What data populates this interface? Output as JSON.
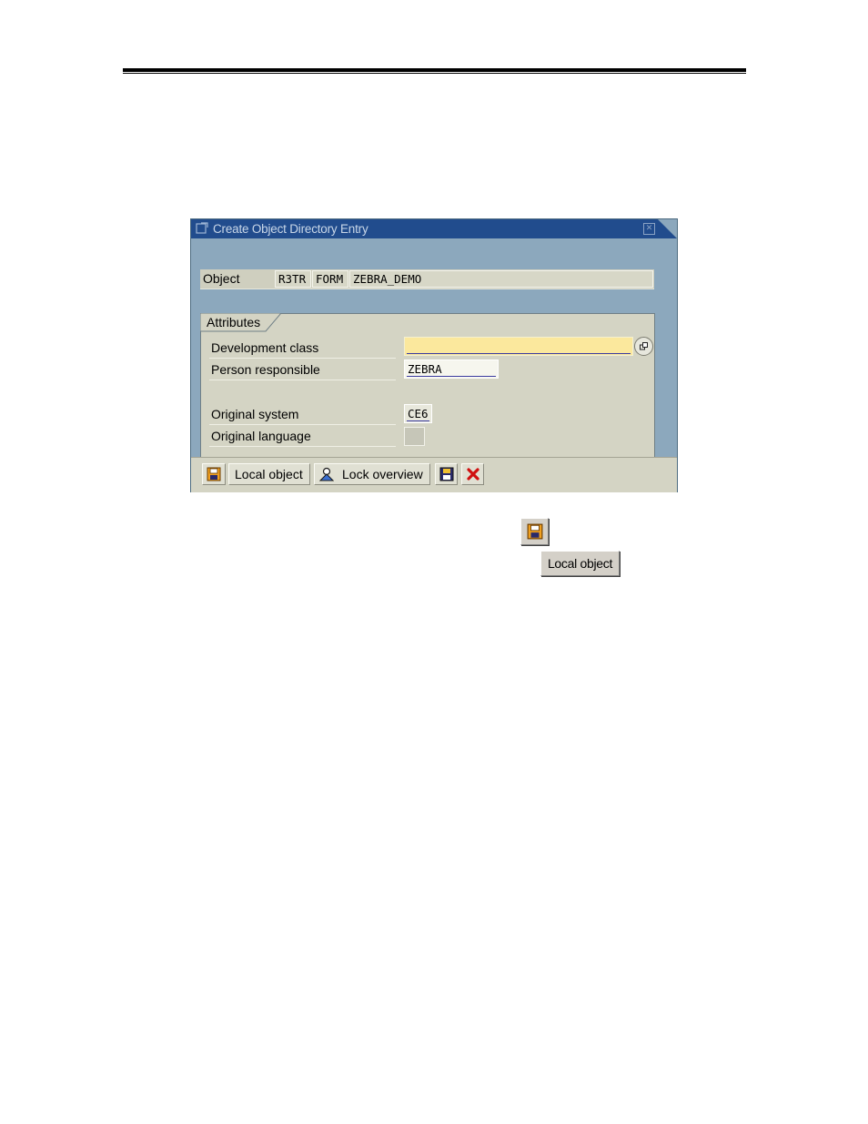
{
  "dialog": {
    "title": "Create Object Directory Entry",
    "object": {
      "label": "Object",
      "fields": [
        "R3TR",
        "FORM",
        "ZEBRA_DEMO"
      ]
    },
    "attributes": {
      "group_label": "Attributes",
      "development_class": {
        "label": "Development class",
        "value": ""
      },
      "person_responsible": {
        "label": "Person responsible",
        "value": "ZEBRA"
      },
      "original_system": {
        "label": "Original system",
        "value": "CE6"
      },
      "original_language": {
        "label": "Original language",
        "value": ""
      }
    },
    "toolbar": {
      "save_icon": "save-icon",
      "local_object_label": "Local object",
      "lock_overview_label": "Lock overview",
      "cancel_icon": "cancel-icon"
    }
  },
  "standalone": {
    "local_object_label": "Local object"
  },
  "colors": {
    "titlebar": "#214c8d",
    "dialog_frame": "#8ca8bd",
    "panel": "#d4d4c4",
    "required_field": "#fbe89d",
    "cancel_red": "#d01010"
  }
}
